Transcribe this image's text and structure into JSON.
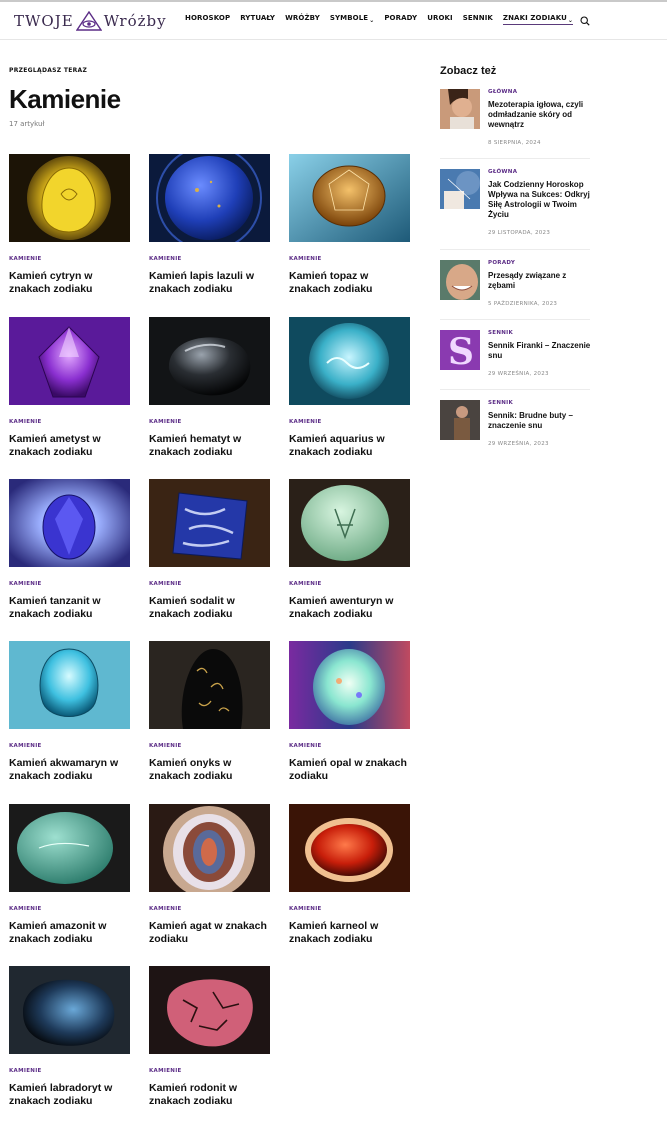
{
  "brand": {
    "name_part1": "Twoje",
    "name_part2": "Wróżby",
    "accent": "#5b2c86"
  },
  "nav": {
    "items": [
      {
        "label": "HOROSKOP"
      },
      {
        "label": "RYTUAŁY"
      },
      {
        "label": "WRÓŻBY"
      },
      {
        "label": "SYMBOLE"
      },
      {
        "label": "PORADY"
      },
      {
        "label": "UROKI"
      },
      {
        "label": "SENNIK"
      },
      {
        "label": "ZNAKI ZODIAKU"
      }
    ],
    "chevron": "⌄"
  },
  "page": {
    "kicker": "PRZEGLĄDASZ TERAZ",
    "title": "Kamienie",
    "count": "17 artykuł"
  },
  "cards": [
    {
      "category": "KAMIENIE",
      "title": "Kamień cytryn w znakach zodiaku",
      "icon": "citrine-image"
    },
    {
      "category": "KAMIENIE",
      "title": "Kamień lapis lazuli w znakach zodiaku",
      "icon": "lapis-image"
    },
    {
      "category": "KAMIENIE",
      "title": "Kamień topaz w znakach zodiaku",
      "icon": "topaz-image"
    },
    {
      "category": "KAMIENIE",
      "title": "Kamień ametyst w znakach zodiaku",
      "icon": "amethyst-image"
    },
    {
      "category": "KAMIENIE",
      "title": "Kamień hematyt w znakach zodiaku",
      "icon": "hematite-image"
    },
    {
      "category": "KAMIENIE",
      "title": "Kamień aquarius w znakach zodiaku",
      "icon": "aquarius-image"
    },
    {
      "category": "KAMIENIE",
      "title": "Kamień tanzanit w znakach zodiaku",
      "icon": "tanzanite-image"
    },
    {
      "category": "KAMIENIE",
      "title": "Kamień sodalit w znakach zodiaku",
      "icon": "sodalite-image"
    },
    {
      "category": "KAMIENIE",
      "title": "Kamień awenturyn w znakach zodiaku",
      "icon": "aventurine-image"
    },
    {
      "category": "KAMIENIE",
      "title": "Kamień akwamaryn w znakach zodiaku",
      "icon": "aquamarine-image"
    },
    {
      "category": "KAMIENIE",
      "title": "Kamień onyks w znakach zodiaku",
      "icon": "onyx-image"
    },
    {
      "category": "KAMIENIE",
      "title": "Kamień opal w znakach zodiaku",
      "icon": "opal-image"
    },
    {
      "category": "KAMIENIE",
      "title": "Kamień amazonit w znakach zodiaku",
      "icon": "amazonite-image"
    },
    {
      "category": "KAMIENIE",
      "title": "Kamień agat w znakach zodiaku",
      "icon": "agate-image"
    },
    {
      "category": "KAMIENIE",
      "title": "Kamień karneol w znakach zodiaku",
      "icon": "carnelian-image"
    },
    {
      "category": "KAMIENIE",
      "title": "Kamień labradoryt w znakach zodiaku",
      "icon": "labradorite-image"
    },
    {
      "category": "KAMIENIE",
      "title": "Kamień rodonit w znakach zodiaku",
      "icon": "rhodonite-image"
    }
  ],
  "sidebar": {
    "title": "Zobacz też",
    "items": [
      {
        "category": "GŁÓWNA",
        "title": "Mezoterapia igłowa, czyli odmładzanie skóry od wewnątrz",
        "date": "8 SIERPNIA, 2024"
      },
      {
        "category": "GŁÓWNA",
        "title": "Jak Codzienny Horoskop Wpływa na Sukces: Odkryj Siłę Astrologii w Twoim Życiu",
        "date": "29 LISTOPADA, 2023"
      },
      {
        "category": "PORADY",
        "title": "Przesądy związane z zębami",
        "date": "5 PAŹDZIERNIKA, 2023"
      },
      {
        "category": "SENNIK",
        "title": "Sennik Firanki – Znaczenie snu",
        "date": "29 WRZEŚNIA, 2023"
      },
      {
        "category": "SENNIK",
        "title": "Sennik: Brudne buty – znaczenie snu",
        "date": "29 WRZEŚNIA, 2023"
      }
    ]
  }
}
